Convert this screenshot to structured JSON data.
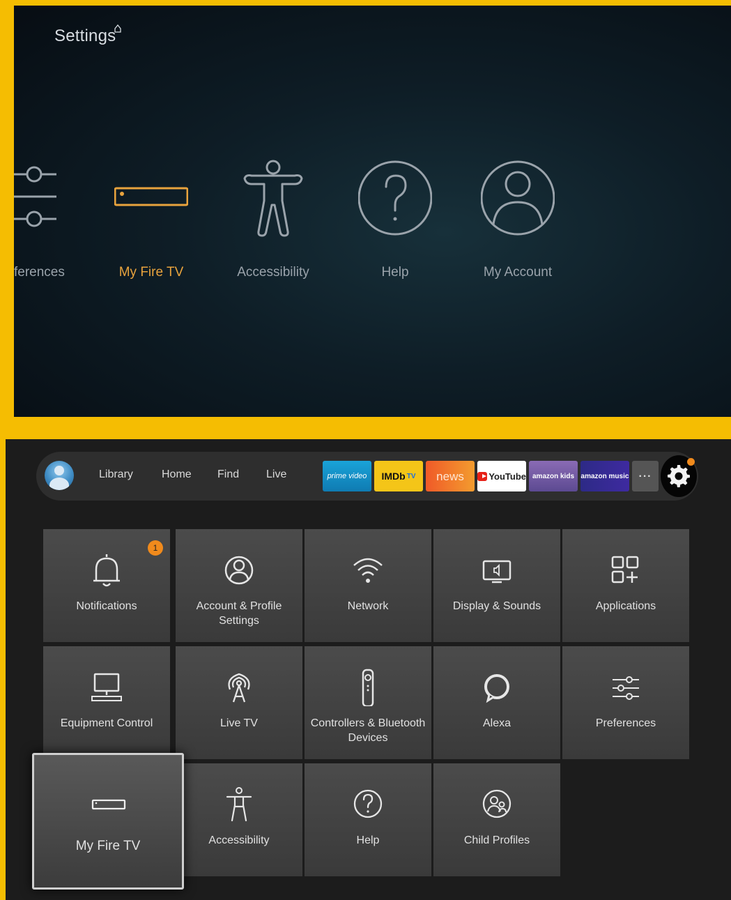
{
  "top_settings": {
    "title": "Settings",
    "items": [
      {
        "id": "preferences",
        "label": "Preferences",
        "visible_label": "ferences",
        "icon": "sliders-icon"
      },
      {
        "id": "my-fire-tv",
        "label": "My Fire TV",
        "icon": "fire-tv-device-icon",
        "selected": true
      },
      {
        "id": "accessibility",
        "label": "Accessibility",
        "icon": "accessibility-icon"
      },
      {
        "id": "help",
        "label": "Help",
        "icon": "help-icon"
      },
      {
        "id": "my-account",
        "label": "My Account",
        "icon": "account-icon"
      }
    ]
  },
  "navbar": {
    "links": [
      "Library",
      "Home",
      "Find",
      "Live"
    ],
    "apps": {
      "prime": "prime video",
      "imdb": "IMDb",
      "imdb_tv": "TV",
      "news": "news",
      "youtube": "YouTube",
      "kids": "amazon kids",
      "music": "amazon music",
      "more": "···"
    }
  },
  "grid": {
    "notifications": {
      "label": "Notifications",
      "badge": "1"
    },
    "account": {
      "label": "Account & Profile Settings"
    },
    "network": {
      "label": "Network"
    },
    "display": {
      "label": "Display & Sounds"
    },
    "applications": {
      "label": "Applications"
    },
    "equipment": {
      "label": "Equipment Control"
    },
    "livetv": {
      "label": "Live TV"
    },
    "controllers": {
      "label": "Controllers & Bluetooth Devices"
    },
    "alexa": {
      "label": "Alexa"
    },
    "preferences": {
      "label": "Preferences"
    },
    "myfiretv": {
      "label": "My Fire TV",
      "selected": true
    },
    "accessibility": {
      "label": "Accessibility"
    },
    "help": {
      "label": "Help"
    },
    "childprofiles": {
      "label": "Child Profiles"
    }
  },
  "colors": {
    "accent_orange": "#e8a33d",
    "frame_yellow": "#f5bd02",
    "badge_orange": "#f08a1c"
  }
}
